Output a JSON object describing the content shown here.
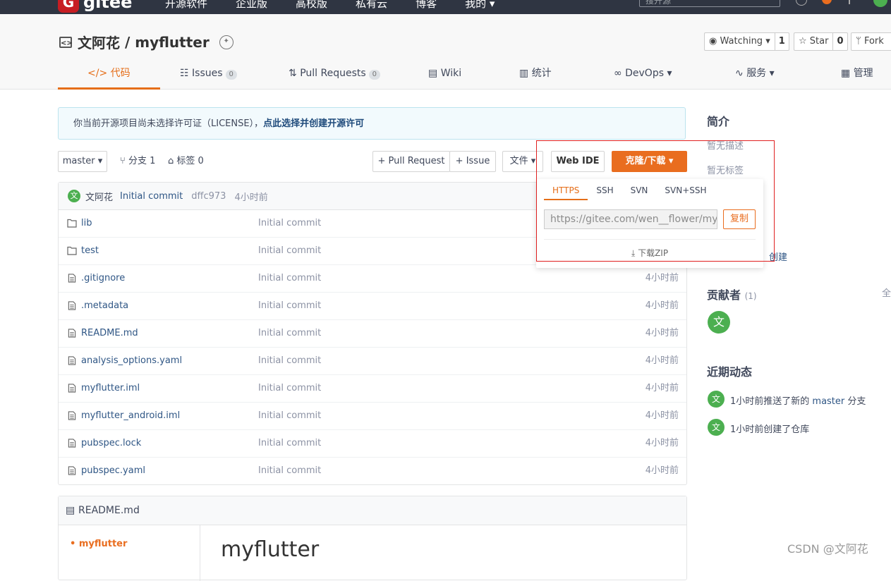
{
  "topbar": {
    "logo_letter": "G",
    "logo_text": "gitee",
    "nav": [
      "开源软件",
      "企业版",
      "高校版",
      "私有云",
      "博客",
      "我的 ▾"
    ],
    "search_placeholder": "搜开源"
  },
  "repo": {
    "owner": "文阿花",
    "separator": " / ",
    "name": "myflutter",
    "watching_label": "Watching ▾",
    "watching_count": "1",
    "star_label": "Star",
    "star_count": "0",
    "fork_label": "Fork"
  },
  "tabs": [
    {
      "icon": "</>",
      "label": "代码"
    },
    {
      "icon": "☷",
      "label": "Issues",
      "count": "0"
    },
    {
      "icon": "⇅",
      "label": "Pull Requests",
      "count": "0"
    },
    {
      "icon": "▤",
      "label": "Wiki"
    },
    {
      "icon": "▥",
      "label": "统计"
    },
    {
      "icon": "∞",
      "label": "DevOps ▾"
    },
    {
      "icon": "∿",
      "label": "服务 ▾"
    },
    {
      "icon": "▦",
      "label": "管理"
    }
  ],
  "notice": {
    "text": "你当前开源项目尚未选择许可证（LICENSE），",
    "link": "点此选择并创建开源许可"
  },
  "toolbar": {
    "branch": "master ▾",
    "branches": "分支 1",
    "tags": "标签 0",
    "pull_request": "+ Pull Request",
    "issue": "+ Issue",
    "file": "文件 ▾",
    "webide": "Web IDE",
    "clone": "克隆/下载 ▾"
  },
  "last_commit": {
    "author": "文阿花",
    "message": "Initial commit",
    "hash": "dffc973",
    "time": "4小时前"
  },
  "files": [
    {
      "type": "folder",
      "name": "lib",
      "message": "Initial commit",
      "time": ""
    },
    {
      "type": "folder",
      "name": "test",
      "message": "Initial commit",
      "time": ""
    },
    {
      "type": "file",
      "name": ".gitignore",
      "message": "Initial commit",
      "time": "4小时前"
    },
    {
      "type": "file",
      "name": ".metadata",
      "message": "Initial commit",
      "time": "4小时前"
    },
    {
      "type": "file",
      "name": "README.md",
      "message": "Initial commit",
      "time": "4小时前"
    },
    {
      "type": "file",
      "name": "analysis_options.yaml",
      "message": "Initial commit",
      "time": "4小时前"
    },
    {
      "type": "file",
      "name": "myflutter.iml",
      "message": "Initial commit",
      "time": "4小时前"
    },
    {
      "type": "file",
      "name": "myflutter_android.iml",
      "message": "Initial commit",
      "time": "4小时前"
    },
    {
      "type": "file",
      "name": "pubspec.lock",
      "message": "Initial commit",
      "time": "4小时前"
    },
    {
      "type": "file",
      "name": "pubspec.yaml",
      "message": "Initial commit",
      "time": "4小时前"
    }
  ],
  "clone_popup": {
    "tabs": [
      "HTTPS",
      "SSH",
      "SVN",
      "SVN+SSH"
    ],
    "url": "https://gitee.com/wen__flower/myflutter.git",
    "copy": "复制",
    "download": "下载ZIP"
  },
  "sidebar": {
    "intro_title": "简介",
    "no_desc": "暂无描述",
    "no_tags": "暂无标签",
    "create_partial": "创建",
    "contributors_title": "贡献者",
    "contributors_count": "(1)",
    "all_partial": "全",
    "contributor_avatar": "文",
    "activity_title": "近期动态",
    "activity": [
      {
        "avatar": "文",
        "prefix": "1小时前推送了新的 ",
        "link": "master",
        "suffix": " 分支"
      },
      {
        "avatar": "文",
        "prefix": "1小时前创建了仓库",
        "link": "",
        "suffix": ""
      }
    ]
  },
  "readme": {
    "title": "README.md",
    "toc_item": "myflutter",
    "heading": "myflutter"
  },
  "watermark": "CSDN @文阿花",
  "colors": {
    "accent": "#e96d1f",
    "link": "#2f5685",
    "avatar": "#4caf50"
  }
}
